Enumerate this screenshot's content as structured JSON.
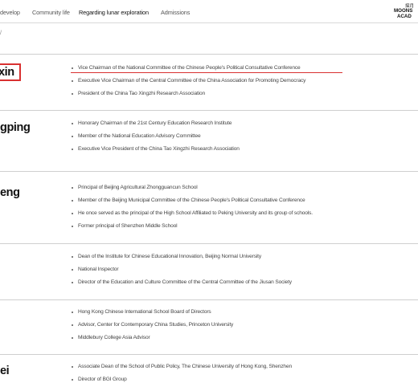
{
  "nav": {
    "items": [
      "develop",
      "Community life",
      "Regarding lunar exploration",
      "Admissions"
    ],
    "logo_zh": "探月",
    "logo_line1": "MOONS",
    "logo_line2": "ACAD"
  },
  "crumb": "/",
  "people": [
    {
      "name": "xin",
      "titles": [
        "Vice Chairman of the National Committee of the Chinese People's Political Consultative Conference",
        "Executive Vice Chairman of the Central Committee of the China Association for Promoting Democracy",
        "President of the China Tao Xingzhi Research Association"
      ]
    },
    {
      "name": "gping",
      "titles": [
        "Honorary Chairman of the 21st Century Education Research Institute",
        "Member of the National Education Advisory Committee",
        "Executive Vice President of the China Tao Xingzhi Research Association"
      ]
    },
    {
      "name": "eng",
      "titles": [
        "Principal of Beijing Agricultural Zhongguancun School",
        "Member of the Beijing Municipal Committee of the Chinese People's Political Consultative Conference",
        "He once served as the principal of the High School Affiliated to Peking University and its group of schools.",
        "Former principal of Shenzhen Middle School"
      ]
    },
    {
      "name": "",
      "titles": [
        "Dean of the Institute for Chinese Educational Innovation, Beijing Normal University",
        "National Inspector",
        "Director of the Education and Culture Committee of the Central Committee of the Jiusan Society"
      ]
    },
    {
      "name": "",
      "titles": [
        "Hong Kong Chinese International School Board of Directors",
        "Advisor, Center for Contemporary China Studies, Princeton University",
        "Middlebury College Asia Advisor"
      ]
    },
    {
      "name": "ei",
      "titles": [
        "Associate Dean of the School of Public Policy, The Chinese University of Hong Kong, Shenzhen",
        "Director of BGI Group"
      ]
    }
  ],
  "colors": {
    "highlight": "#d93030",
    "divider": "#cfcfcf"
  }
}
